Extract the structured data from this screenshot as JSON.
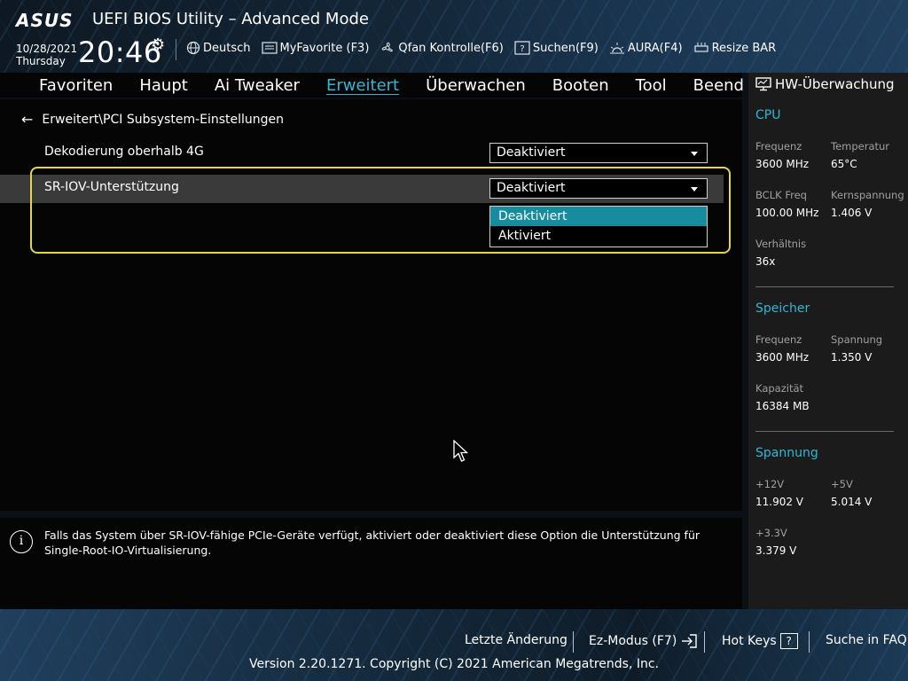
{
  "header": {
    "logo": "ASUS",
    "title": "UEFI BIOS Utility – Advanced Mode",
    "date": "10/28/2021",
    "day": "Thursday",
    "time": "20:46",
    "toolbar": [
      {
        "label": "Deutsch",
        "icon": "globe-icon"
      },
      {
        "label": "MyFavorite (F3)",
        "icon": "favorite-list-icon"
      },
      {
        "label": "Qfan Kontrolle(F6)",
        "icon": "fan-icon"
      },
      {
        "label": "Suchen(F9)",
        "icon": "search-help-icon"
      },
      {
        "label": "AURA(F4)",
        "icon": "aura-light-icon"
      },
      {
        "label": "Resize BAR",
        "icon": "resize-bar-icon"
      }
    ]
  },
  "tabs": [
    {
      "label": "Favoriten",
      "active": false
    },
    {
      "label": "Haupt",
      "active": false
    },
    {
      "label": "Ai Tweaker",
      "active": false
    },
    {
      "label": "Erweitert",
      "active": true
    },
    {
      "label": "Überwachen",
      "active": false
    },
    {
      "label": "Booten",
      "active": false
    },
    {
      "label": "Tool",
      "active": false
    },
    {
      "label": "Beend",
      "active": false
    }
  ],
  "main": {
    "breadcrumb": "Erweitert\\PCI Subsystem-Einstellungen",
    "settings": [
      {
        "label": "Dekodierung oberhalb 4G",
        "value": "Deaktiviert"
      },
      {
        "label": "SR-IOV-Unterstützung",
        "value": "Deaktiviert"
      }
    ],
    "dropdown_options": [
      {
        "label": "Deaktiviert",
        "selected": true
      },
      {
        "label": "Aktiviert",
        "selected": false
      }
    ]
  },
  "help": {
    "line1": "Falls das System über SR-IOV-fähige PCIe-Geräte verfügt, aktiviert oder deaktiviert diese Option die Unterstützung für",
    "line2": "Single-Root-IO-Virtualisierung."
  },
  "hw": {
    "title": "HW-Überwachung",
    "cpu": {
      "heading": "CPU",
      "freq_label": "Frequenz",
      "freq": "3600 MHz",
      "temp_label": "Temperatur",
      "temp": "65°C",
      "bclk_label": "BCLK Freq",
      "bclk": "100.00 MHz",
      "core_v_label": "Kernspannung",
      "core_v": "1.406 V",
      "ratio_label": "Verhältnis",
      "ratio": "36x"
    },
    "memory": {
      "heading": "Speicher",
      "freq_label": "Frequenz",
      "freq": "3600 MHz",
      "volt_label": "Spannung",
      "volt": "1.350 V",
      "cap_label": "Kapazität",
      "cap": "16384 MB"
    },
    "voltage": {
      "heading": "Spannung",
      "v12_label": "+12V",
      "v12": "11.902 V",
      "v5_label": "+5V",
      "v5": "5.014 V",
      "v33_label": "+3.3V",
      "v33": "3.379 V"
    }
  },
  "footer": {
    "last_change": "Letzte Änderung",
    "ez_mode": "Ez-Modus (F7)",
    "hot_keys": "Hot Keys",
    "hot_keys_key": "?",
    "faq": "Suche in FAQ",
    "copyright": "Version 2.20.1271. Copyright (C) 2021 American Megatrends, Inc."
  },
  "colors": {
    "accent": "#31b7d6",
    "selected_option": "#168c9e",
    "focus_frame": "#e5d44d"
  }
}
